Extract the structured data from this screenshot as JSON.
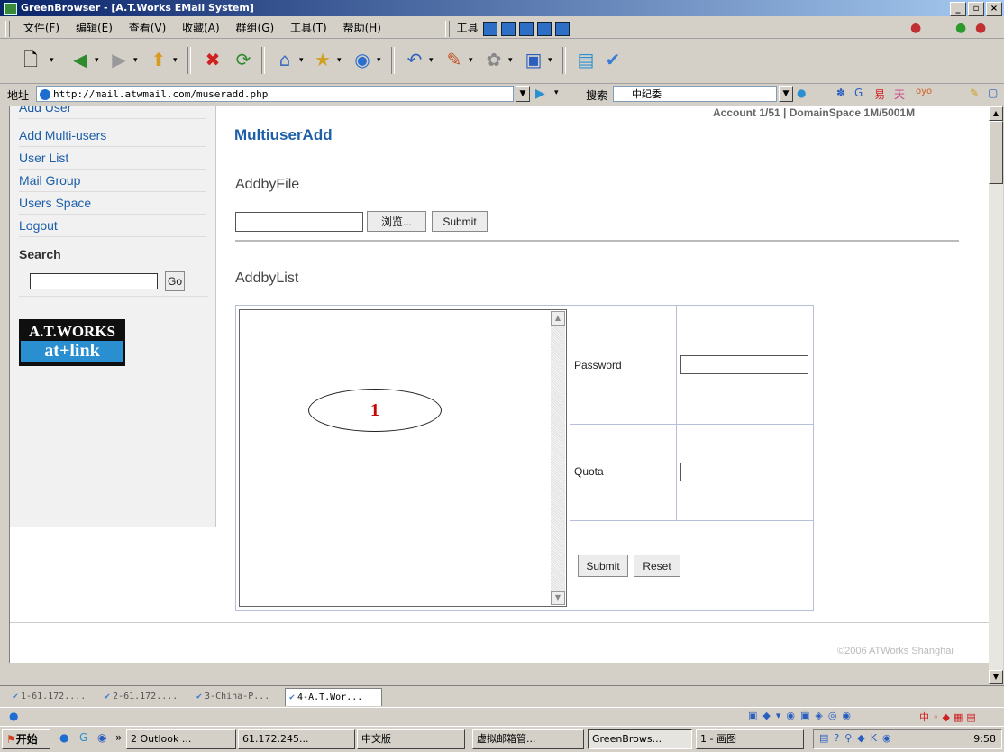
{
  "window": {
    "title": "GreenBrowser - [A.T.Works EMail System]",
    "min": "_",
    "max": "▫",
    "close": "×"
  },
  "menu": {
    "items": [
      "文件(F)",
      "编辑(E)",
      "查看(V)",
      "收藏(A)",
      "群组(G)",
      "工具(T)",
      "帮助(H)"
    ],
    "tools_label": "工具"
  },
  "address": {
    "label": "地址",
    "url": "http://mail.atwmail.com/museradd.php",
    "search_label": "搜索",
    "search_value": "中纪委"
  },
  "sidebar": {
    "items": [
      "Add User",
      "Add Multi-users",
      "User List",
      "Mail Group",
      "Users Space",
      "Logout"
    ],
    "search_title": "Search",
    "go_label": "Go",
    "logo_top": "A.T.WORKS",
    "logo_bottom": "at+link"
  },
  "main": {
    "account_info": "Account 1/51 | DomainSpace 1M/5001M",
    "title": "MultiuserAdd",
    "add_by_file": "AddbyFile",
    "browse_label": "浏览...",
    "submit_label": "Submit",
    "add_by_list": "AddbyList",
    "password_label": "Password",
    "quota_label": "Quota",
    "form_submit": "Submit",
    "form_reset": "Reset",
    "annotation": "1",
    "copyright": "©2006 ATWorks Shanghai"
  },
  "tabs": [
    "1-61.172....",
    "2-61.172....",
    "3-China-P...",
    "4-A.T.Wor..."
  ],
  "taskbar": {
    "start": "开始",
    "tasks": [
      "2 Outlook ...",
      "61.172.245...",
      "中文版",
      "虚拟邮箱管...",
      "GreenBrows...",
      "1 - 画图"
    ],
    "clock": "9:58"
  },
  "colors": {
    "link": "#1d5fa8",
    "title_bar": "#0a246a",
    "chrome": "#d4d0c8"
  }
}
